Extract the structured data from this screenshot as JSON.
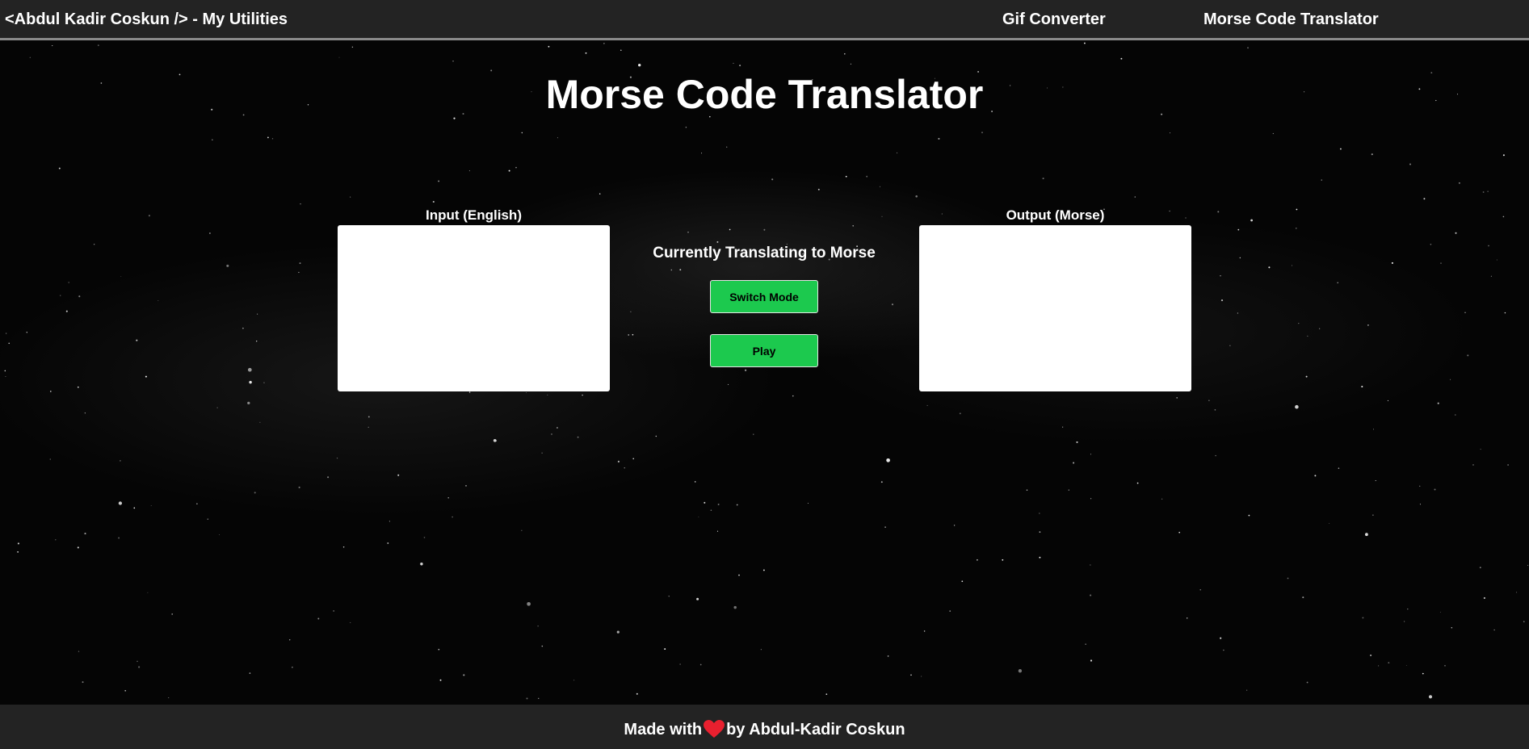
{
  "navbar": {
    "brand": "<Abdul Kadir Coskun /> - My Utilities",
    "links": [
      {
        "label": "Gif Converter"
      },
      {
        "label": "Morse Code Translator"
      }
    ]
  },
  "main": {
    "title": "Morse Code Translator",
    "input": {
      "label": "Input (English)",
      "value": ""
    },
    "output": {
      "label": "Output (Morse)",
      "value": ""
    },
    "mode_text": "Currently Translating to Morse",
    "switch_label": "Switch Mode",
    "play_label": "Play"
  },
  "footer": {
    "prefix": "Made with",
    "suffix": "by Abdul-Kadir Coskun",
    "icon": "heart-icon"
  },
  "colors": {
    "accent_button": "#1cc94e",
    "bar_background": "#232323",
    "heart": "#e8202f"
  }
}
